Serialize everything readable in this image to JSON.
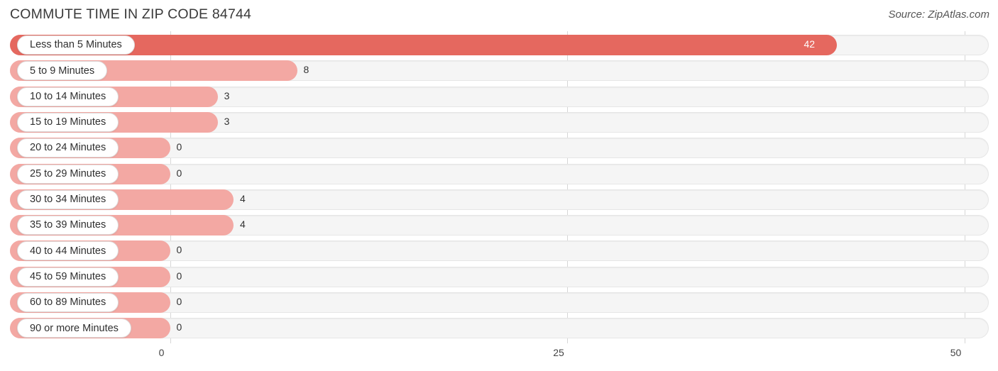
{
  "header": {
    "title": "COMMUTE TIME IN ZIP CODE 84744",
    "source": "Source: ZipAtlas.com"
  },
  "colors": {
    "bar_primary": "#e5685f",
    "bar_secondary": "#f3a8a3",
    "track": "#f5f5f5",
    "track_border": "#e6e6e6",
    "gridline": "#d6d6d6",
    "text": "#333333",
    "value_inside": "#ffffff"
  },
  "chart_data": {
    "type": "bar",
    "orientation": "horizontal",
    "title": "COMMUTE TIME IN ZIP CODE 84744",
    "xlabel": "",
    "ylabel": "",
    "xlim": [
      0,
      50
    ],
    "xticks": [
      0,
      25,
      50
    ],
    "xtick_labels": [
      "0",
      "25",
      "50"
    ],
    "grid": true,
    "legend": null,
    "categories": [
      "Less than 5 Minutes",
      "5 to 9 Minutes",
      "10 to 14 Minutes",
      "15 to 19 Minutes",
      "20 to 24 Minutes",
      "25 to 29 Minutes",
      "30 to 34 Minutes",
      "35 to 39 Minutes",
      "40 to 44 Minutes",
      "45 to 59 Minutes",
      "60 to 89 Minutes",
      "90 or more Minutes"
    ],
    "values": [
      42,
      8,
      3,
      3,
      0,
      0,
      4,
      4,
      0,
      0,
      0,
      0
    ],
    "value_labels": [
      "42",
      "8",
      "3",
      "3",
      "0",
      "0",
      "4",
      "4",
      "0",
      "0",
      "0",
      "0"
    ]
  }
}
